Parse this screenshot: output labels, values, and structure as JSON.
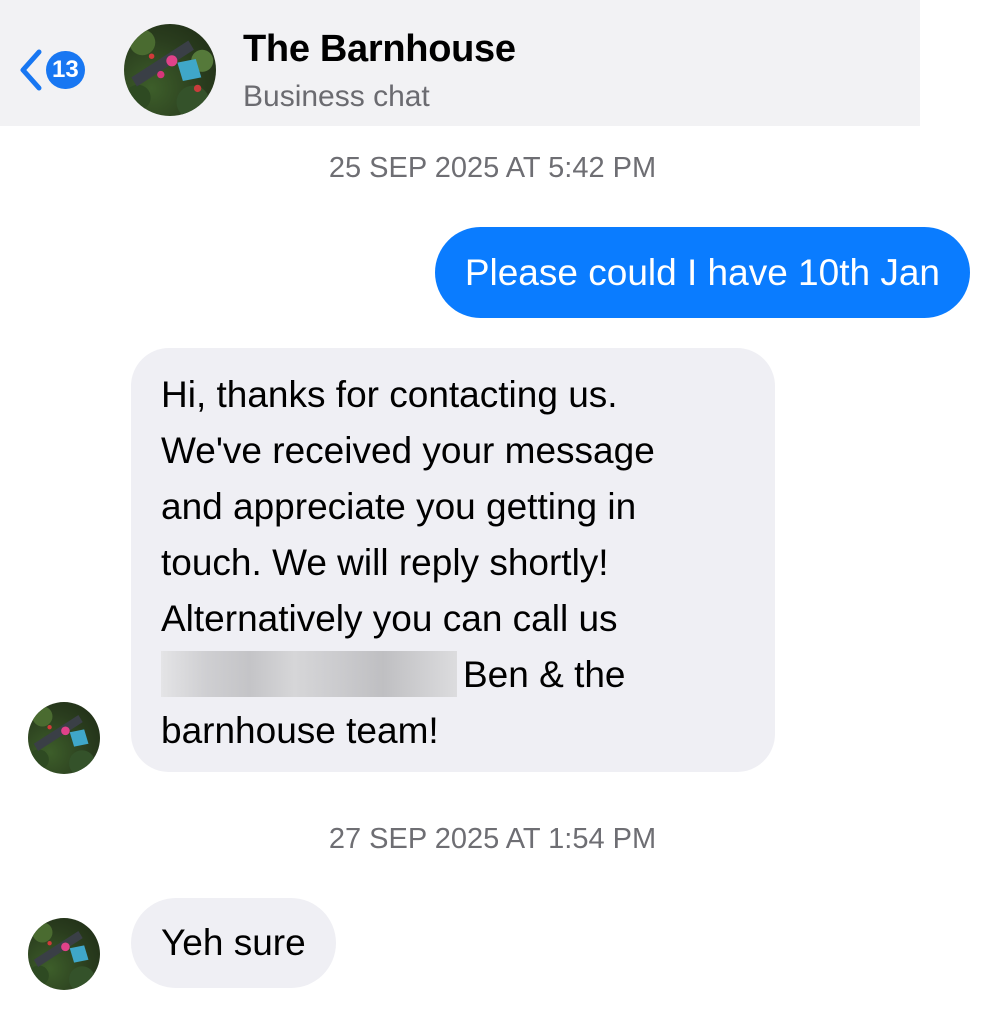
{
  "header": {
    "back_badge": "13",
    "title": "The Barnhouse",
    "subtitle": "Business chat"
  },
  "messages": [
    {
      "type": "timestamp",
      "text": "25 SEP 2025 AT 5:42 PM"
    },
    {
      "type": "outgoing",
      "text": "Please could I have 10th Jan"
    },
    {
      "type": "incoming",
      "lines": [
        "Hi, thanks for contacting us.",
        "We've received your message",
        "and appreciate you getting in",
        "touch. We will reply shortly!",
        "Alternatively you can call us",
        "Ben & the",
        "barnhouse team!"
      ],
      "redacted": true
    },
    {
      "type": "timestamp",
      "text": "27 SEP 2025 AT 1:54 PM"
    },
    {
      "type": "incoming",
      "text": "Yeh sure"
    }
  ],
  "colors": {
    "accent": "#0a7cff",
    "incoming_bubble": "#efeff4",
    "header_bg": "#f2f2f4",
    "timestamp": "#6e6e73"
  },
  "icons": {
    "back": "chevron-left-icon",
    "avatar": "barnhouse-logo-avatar"
  }
}
